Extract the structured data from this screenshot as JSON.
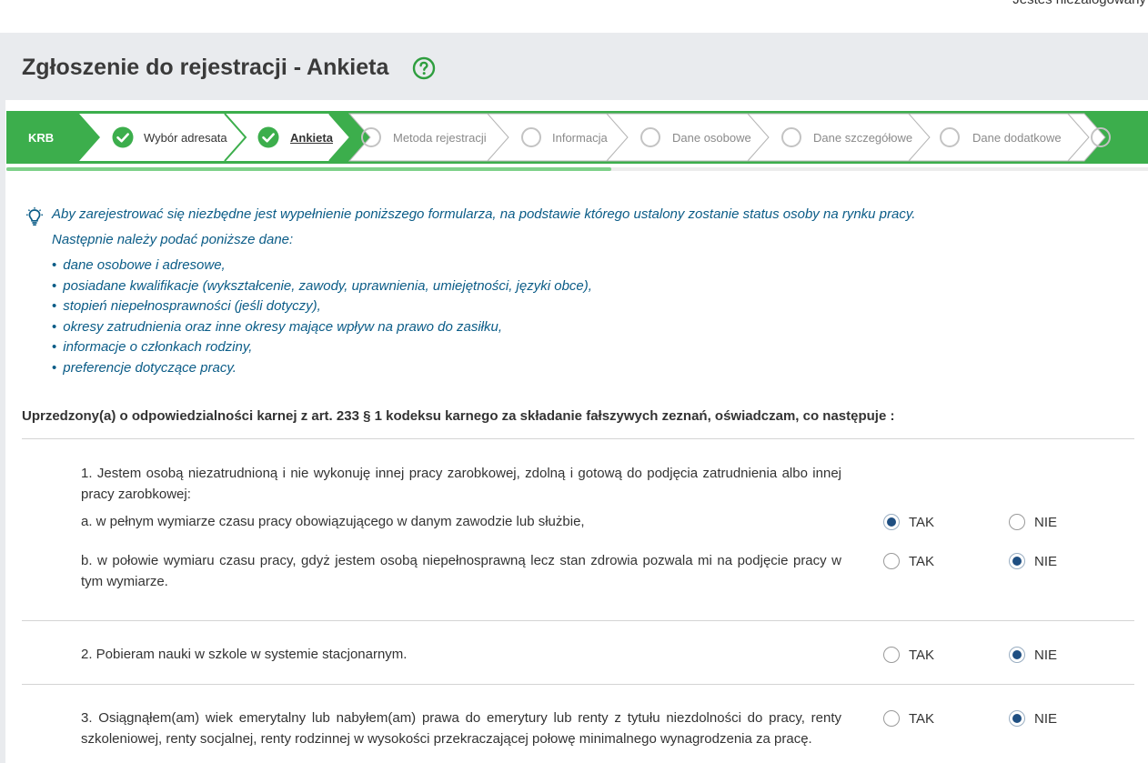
{
  "header": {
    "login_status": "Jesteś niezalogowany",
    "title": "Zgłoszenie do rejestracji - Ankieta",
    "help_icon": "question-circle-icon"
  },
  "wizard": {
    "steps": [
      {
        "label": "KRB",
        "state": "start"
      },
      {
        "label": "Wybór adresata",
        "state": "done"
      },
      {
        "label": "Ankieta",
        "state": "active"
      },
      {
        "label": "Metoda rejestracji",
        "state": "pending"
      },
      {
        "label": "Informacja",
        "state": "pending"
      },
      {
        "label": "Dane osobowe",
        "state": "pending"
      },
      {
        "label": "Dane szczegółowe",
        "state": "pending"
      },
      {
        "label": "Dane dodatkowe",
        "state": "pending"
      }
    ],
    "progress_fraction": 0.53,
    "accent_color": "#3cae4c"
  },
  "info": {
    "icon": "lightbulb-icon",
    "line1": "Aby zarejestrować się niezbędne jest wypełnienie poniższego formularza, na podstawie którego ustalony zostanie status osoby na rynku pracy.",
    "line2": "Następnie należy podać poniższe dane:",
    "items": [
      "dane osobowe i adresowe,",
      "posiadane kwalifikacje (wykształcenie, zawody, uprawnienia, umiejętności, języki obce),",
      "stopień niepełnosprawności (jeśli dotyczy),",
      "okresy zatrudnienia oraz inne okresy mające wpływ na prawo do zasiłku,",
      "informacje o członkach rodziny,",
      "preferencje dotyczące pracy."
    ]
  },
  "declaration": "Uprzedzony(a) o odpowiedzialności karnej z art. 233 § 1 kodeksu karnego za składanie fałszywych zeznań, oświadczam, co następuje :",
  "options": {
    "yes": "TAK",
    "no": "NIE"
  },
  "questions": {
    "q1": "1.  Jestem osobą niezatrudnioną i nie wykonuję innej pracy zarobkowej, zdolną i gotową do podjęcia zatrudnienia albo innej pracy zarobkowej:",
    "q1a": "a.  w pełnym wymiarze czasu pracy obowiązującego w danym zawodzie lub służbie,",
    "q1a_answer": "TAK",
    "q1b": "b.  w połowie wymiaru czasu pracy, gdyż jestem osobą niepełnosprawną lecz stan zdrowia pozwala mi na podjęcie pracy w tym wymiarze.",
    "q1b_answer": "NIE",
    "q2": "2.  Pobieram nauki w szkole w systemie stacjonarnym.",
    "q2_answer": "NIE",
    "q3": "3.  Osiągnąłem(am) wiek emerytalny lub nabyłem(am) prawa do emerytury lub renty z tytułu niezdolności do pracy, renty szkoleniowej, renty socjalnej, renty rodzinnej w wysokości przekraczającej połowę minimalnego wynagrodzenia za pracę.",
    "q3_answer": "NIE"
  }
}
